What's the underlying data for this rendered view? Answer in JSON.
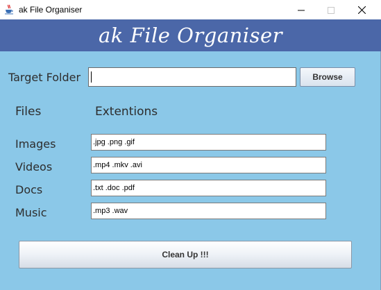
{
  "window": {
    "title": "ak File Organiser",
    "banner_title": "ak File Organiser"
  },
  "target": {
    "label": "Target Folder",
    "value": "",
    "browse_label": "Browse"
  },
  "headers": {
    "files": "Files",
    "extensions": "Extentions"
  },
  "rows": [
    {
      "label": "Images",
      "value": ".jpg .png .gif"
    },
    {
      "label": "Videos",
      "value": ".mp4 .mkv .avi"
    },
    {
      "label": "Docs",
      "value": ".txt .doc .pdf"
    },
    {
      "label": "Music",
      "value": ".mp3 .wav"
    }
  ],
  "actions": {
    "cleanup_label": "Clean Up !!!"
  },
  "colors": {
    "background": "#8bc8e8",
    "banner": "#4b67a8"
  },
  "icons": {
    "app": "java-cup-icon",
    "minimize": "minimize-icon",
    "maximize": "maximize-icon",
    "close": "close-icon"
  }
}
